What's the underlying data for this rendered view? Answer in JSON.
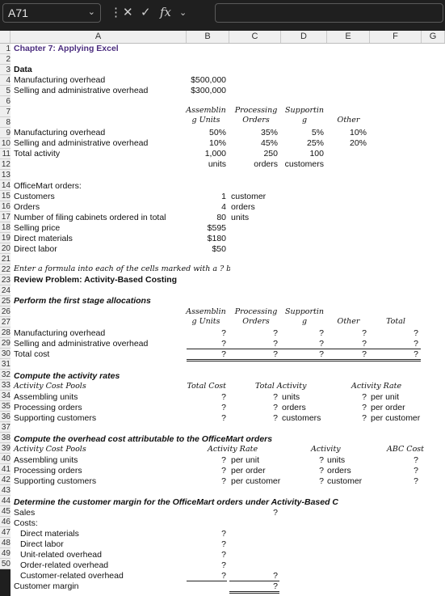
{
  "formula_bar": {
    "name_box": "A71",
    "fx_label": "fx",
    "formula": ""
  },
  "columns": [
    "A",
    "B",
    "C",
    "D",
    "E",
    "F",
    "G"
  ],
  "title": "Chapter 7: Applying Excel",
  "data_section": {
    "label": "Data",
    "mfg_overhead_label": "Manufacturing overhead",
    "mfg_overhead": "$500,000",
    "sga_label": "Selling and administrative overhead",
    "sga": "$300,000"
  },
  "pools_header": {
    "assembly": [
      "Assemblin",
      "g Units"
    ],
    "processing": [
      "Processing",
      "Orders"
    ],
    "supporting": [
      "Supportin",
      "g"
    ],
    "other": "Other",
    "total": "Total"
  },
  "distribution": {
    "mfg": {
      "label": "Manufacturing overhead",
      "values": [
        "50%",
        "35%",
        "5%",
        "10%"
      ]
    },
    "sga": {
      "label": "Selling and administrative overhead",
      "values": [
        "10%",
        "45%",
        "25%",
        "20%"
      ]
    },
    "total": {
      "label": "Total activity",
      "values": [
        "1,000",
        "250",
        "100"
      ]
    },
    "units": [
      "units",
      "orders",
      "customers"
    ]
  },
  "officemart": {
    "label": "OfficeMart orders:",
    "rows": [
      {
        "label": "Customers",
        "value": "1",
        "unit": "customer"
      },
      {
        "label": "Orders",
        "value": "4",
        "unit": "orders"
      },
      {
        "label": "Number of filing cabinets ordered in total",
        "value": "80",
        "unit": "units"
      },
      {
        "label": "Selling price",
        "value": "$595",
        "unit": ""
      },
      {
        "label": "Direct materials",
        "value": "$180",
        "unit": ""
      },
      {
        "label": "Direct labor",
        "value": "$50",
        "unit": ""
      }
    ]
  },
  "instruction": "Enter a formula into each of the cells marked with a ? below",
  "review_title": "Review Problem: Activity-Based Costing",
  "first_stage": {
    "heading": "Perform the first stage allocations",
    "rows": [
      {
        "label": "Manufacturing overhead",
        "values": [
          "?",
          "?",
          "?",
          "?",
          "?"
        ]
      },
      {
        "label": "Selling and administrative overhead",
        "values": [
          "?",
          "?",
          "?",
          "?",
          "?"
        ]
      },
      {
        "label": "Total cost",
        "values": [
          "?",
          "?",
          "?",
          "?",
          "?"
        ]
      }
    ]
  },
  "rates": {
    "heading": "Compute the activity rates",
    "col_pools": "Activity Cost Pools",
    "col_total": "Total Cost",
    "col_activity": "Total Activity",
    "col_rate": "Activity Rate",
    "rows": [
      {
        "label": "Assembling units",
        "total": "?",
        "activity": "?",
        "unit": "units",
        "rate": "?",
        "rate_unit": "per unit"
      },
      {
        "label": "Processing orders",
        "total": "?",
        "activity": "?",
        "unit": "orders",
        "rate": "?",
        "rate_unit": "per order"
      },
      {
        "label": "Supporting customers",
        "total": "?",
        "activity": "?",
        "unit": "customers",
        "rate": "?",
        "rate_unit": "per customer"
      }
    ]
  },
  "overhead_cost": {
    "heading": "Compute the overhead cost attributable to the OfficeMart orders",
    "col_pools": "Activity Cost Pools",
    "col_rate": "Activity Rate",
    "col_activity": "Activity",
    "col_abc": "ABC Cost",
    "rows": [
      {
        "label": "Assembling units",
        "rate": "?",
        "rate_unit": "per unit",
        "activity": "?",
        "unit": "units",
        "abc": "?"
      },
      {
        "label": "Processing orders",
        "rate": "?",
        "rate_unit": "per order",
        "activity": "?",
        "unit": "orders",
        "abc": "?"
      },
      {
        "label": "Supporting customers",
        "rate": "?",
        "rate_unit": "per customer",
        "activity": "?",
        "unit": "customer",
        "abc": "?"
      }
    ]
  },
  "margin": {
    "heading": "Determine the customer margin for the OfficeMart orders under Activity-Based C",
    "sales_label": "Sales",
    "sales": "?",
    "costs_label": "Costs:",
    "cost_rows": [
      {
        "label": "Direct materials",
        "value": "?"
      },
      {
        "label": "Direct labor",
        "value": "?"
      },
      {
        "label": "Unit-related overhead",
        "value": "?"
      },
      {
        "label": "Order-related overhead",
        "value": "?"
      },
      {
        "label": "Customer-related overhead",
        "value": "?"
      }
    ],
    "cost_total": "?",
    "customer_margin_label": "Customer margin",
    "customer_margin": "?"
  },
  "row_numbers": [
    "1",
    "2",
    "3",
    "4",
    "5",
    "6",
    "7",
    "8",
    "9",
    "10",
    "11",
    "12",
    "13",
    "14",
    "15",
    "16",
    "17",
    "18",
    "19",
    "20",
    "21",
    "22",
    "23",
    "24",
    "25",
    "26",
    "27",
    "28",
    "29",
    "30",
    "31",
    "32",
    "33",
    "34",
    "35",
    "36",
    "37",
    "38",
    "39",
    "40",
    "41",
    "42",
    "43",
    "44",
    "45",
    "46",
    "47",
    "48",
    "49",
    "50"
  ]
}
